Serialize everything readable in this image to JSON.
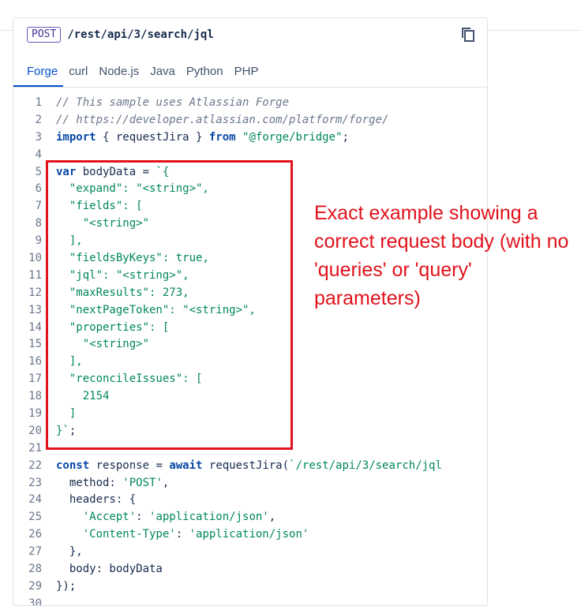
{
  "endpoint": {
    "method": "POST",
    "path": "/rest/api/3/search/jql"
  },
  "tabs": [
    "Forge",
    "curl",
    "Node.js",
    "Java",
    "Python",
    "PHP"
  ],
  "active_tab": "Forge",
  "code_lines": [
    {
      "n": "1",
      "segs": [
        [
          "c",
          "// This sample uses Atlassian Forge"
        ]
      ]
    },
    {
      "n": "2",
      "segs": [
        [
          "c",
          "// https://developer.atlassian.com/platform/forge/"
        ]
      ]
    },
    {
      "n": "3",
      "segs": [
        [
          "k",
          "import"
        ],
        [
          "p",
          " { requestJira } "
        ],
        [
          "k",
          "from"
        ],
        [
          "p",
          " "
        ],
        [
          "s",
          "\"@forge/bridge\""
        ],
        [
          "p",
          ";"
        ]
      ]
    },
    {
      "n": "4",
      "segs": []
    },
    {
      "n": "5",
      "segs": [
        [
          "k",
          "var"
        ],
        [
          "p",
          " bodyData = "
        ],
        [
          "s",
          "`{"
        ]
      ]
    },
    {
      "n": "6",
      "segs": [
        [
          "s",
          "  \"expand\": \"<string>\","
        ]
      ]
    },
    {
      "n": "7",
      "segs": [
        [
          "s",
          "  \"fields\": ["
        ]
      ]
    },
    {
      "n": "8",
      "segs": [
        [
          "s",
          "    \"<string>\""
        ]
      ]
    },
    {
      "n": "9",
      "segs": [
        [
          "s",
          "  ],"
        ]
      ]
    },
    {
      "n": "10",
      "segs": [
        [
          "s",
          "  \"fieldsByKeys\": true,"
        ]
      ]
    },
    {
      "n": "11",
      "segs": [
        [
          "s",
          "  \"jql\": \"<string>\","
        ]
      ]
    },
    {
      "n": "12",
      "segs": [
        [
          "s",
          "  \"maxResults\": 273,"
        ]
      ]
    },
    {
      "n": "13",
      "segs": [
        [
          "s",
          "  \"nextPageToken\": \"<string>\","
        ]
      ]
    },
    {
      "n": "14",
      "segs": [
        [
          "s",
          "  \"properties\": ["
        ]
      ]
    },
    {
      "n": "15",
      "segs": [
        [
          "s",
          "    \"<string>\""
        ]
      ]
    },
    {
      "n": "16",
      "segs": [
        [
          "s",
          "  ],"
        ]
      ]
    },
    {
      "n": "17",
      "segs": [
        [
          "s",
          "  \"reconcileIssues\": ["
        ]
      ]
    },
    {
      "n": "18",
      "segs": [
        [
          "s",
          "    2154"
        ]
      ]
    },
    {
      "n": "19",
      "segs": [
        [
          "s",
          "  ]"
        ]
      ]
    },
    {
      "n": "20",
      "segs": [
        [
          "s",
          "}`"
        ],
        [
          "p",
          ";"
        ]
      ]
    },
    {
      "n": "21",
      "segs": []
    },
    {
      "n": "22",
      "segs": [
        [
          "k",
          "const"
        ],
        [
          "p",
          " response = "
        ],
        [
          "k",
          "await"
        ],
        [
          "p",
          " requestJira("
        ],
        [
          "s",
          "`/rest/api/3/search/jql"
        ]
      ]
    },
    {
      "n": "23",
      "segs": [
        [
          "p",
          "  method: "
        ],
        [
          "s",
          "'POST'"
        ],
        [
          "p",
          ","
        ]
      ]
    },
    {
      "n": "24",
      "segs": [
        [
          "p",
          "  headers: {"
        ]
      ]
    },
    {
      "n": "25",
      "segs": [
        [
          "p",
          "    "
        ],
        [
          "s",
          "'Accept'"
        ],
        [
          "p",
          ": "
        ],
        [
          "s",
          "'application/json'"
        ],
        [
          "p",
          ","
        ]
      ]
    },
    {
      "n": "26",
      "segs": [
        [
          "p",
          "    "
        ],
        [
          "s",
          "'Content-Type'"
        ],
        [
          "p",
          ": "
        ],
        [
          "s",
          "'application/json'"
        ]
      ]
    },
    {
      "n": "27",
      "segs": [
        [
          "p",
          "  },"
        ]
      ]
    },
    {
      "n": "28",
      "segs": [
        [
          "p",
          "  body: bodyData"
        ]
      ]
    },
    {
      "n": "29",
      "segs": [
        [
          "p",
          "});"
        ]
      ]
    },
    {
      "n": "30",
      "segs": []
    }
  ],
  "annotation": "Exact example showing a correct request body (with no 'queries' or 'query' parameters)",
  "colors": {
    "accent": "#0052cc",
    "annotation": "#e2111b",
    "keyword": "#0747a6",
    "string": "#00875a",
    "comment": "#6b778c"
  }
}
